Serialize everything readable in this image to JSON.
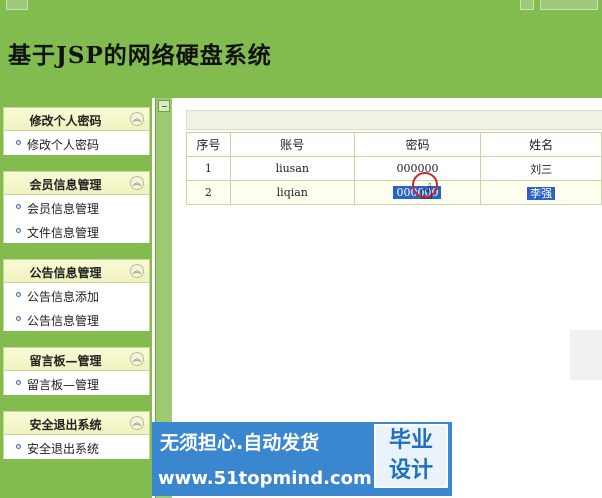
{
  "header": {
    "title": "基于JSP的网络硬盘系统"
  },
  "sidebar": {
    "groups": [
      {
        "title": "修改个人密码",
        "items": [
          "修改个人密码"
        ]
      },
      {
        "title": "会员信息管理",
        "items": [
          "会员信息管理",
          "文件信息管理"
        ]
      },
      {
        "title": "公告信息管理",
        "items": [
          "公告信息添加",
          "公告信息管理"
        ]
      },
      {
        "title": "留言板—管理",
        "items": [
          "留言板—管理"
        ]
      },
      {
        "title": "安全退出系统",
        "items": [
          "安全退出系统"
        ]
      }
    ],
    "collapse_icon": "double-chevron-up"
  },
  "table": {
    "headers": [
      "序号",
      "账号",
      "密码",
      "姓名"
    ],
    "rows": [
      {
        "index": "1",
        "account": "liusan",
        "password": "000000",
        "name": "刘三"
      },
      {
        "index": "2",
        "account": "liqian",
        "password": "000000",
        "name": "李强"
      }
    ]
  },
  "watermark": {
    "slogan": "无须担心.自动发货",
    "url": "www.51topmind.com",
    "badge_line1": "毕业",
    "badge_line2": "设计"
  },
  "colors": {
    "header_green": "#82bb4e",
    "menu_head": "#f0f1bf",
    "selection_blue": "#2a62c6",
    "watermark_blue": "#3a86cf"
  }
}
